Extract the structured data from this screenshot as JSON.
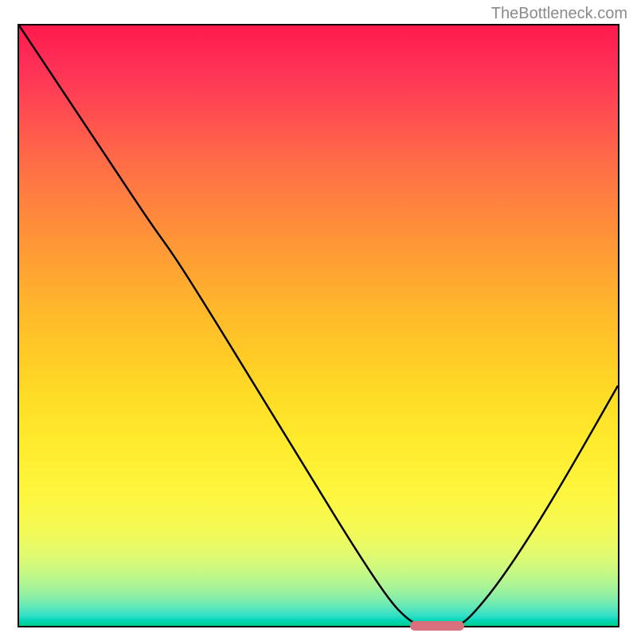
{
  "attribution": "TheBottleneck.com",
  "chart_data": {
    "type": "line",
    "title": "",
    "xlabel": "",
    "ylabel": "",
    "x_range": [
      0,
      100
    ],
    "y_range": [
      0,
      100
    ],
    "curve_points": [
      {
        "x": 0,
        "y": 100
      },
      {
        "x": 8,
        "y": 88
      },
      {
        "x": 16,
        "y": 76
      },
      {
        "x": 22,
        "y": 67
      },
      {
        "x": 26,
        "y": 61.5
      },
      {
        "x": 32,
        "y": 52
      },
      {
        "x": 40,
        "y": 39
      },
      {
        "x": 48,
        "y": 26
      },
      {
        "x": 56,
        "y": 13
      },
      {
        "x": 62,
        "y": 4
      },
      {
        "x": 65,
        "y": 1
      },
      {
        "x": 67,
        "y": 0
      },
      {
        "x": 73,
        "y": 0
      },
      {
        "x": 75,
        "y": 1
      },
      {
        "x": 80,
        "y": 7
      },
      {
        "x": 86,
        "y": 16
      },
      {
        "x": 92,
        "y": 26
      },
      {
        "x": 100,
        "y": 40
      }
    ],
    "valley_marker": {
      "x_start": 65,
      "x_end": 74,
      "y": 0.5
    },
    "gradient_stops": [
      {
        "pos": 0,
        "color": "#ff1a4d"
      },
      {
        "pos": 50,
        "color": "#ffba2b"
      },
      {
        "pos": 85,
        "color": "#f4fa55"
      },
      {
        "pos": 100,
        "color": "#00cf8a"
      }
    ]
  }
}
